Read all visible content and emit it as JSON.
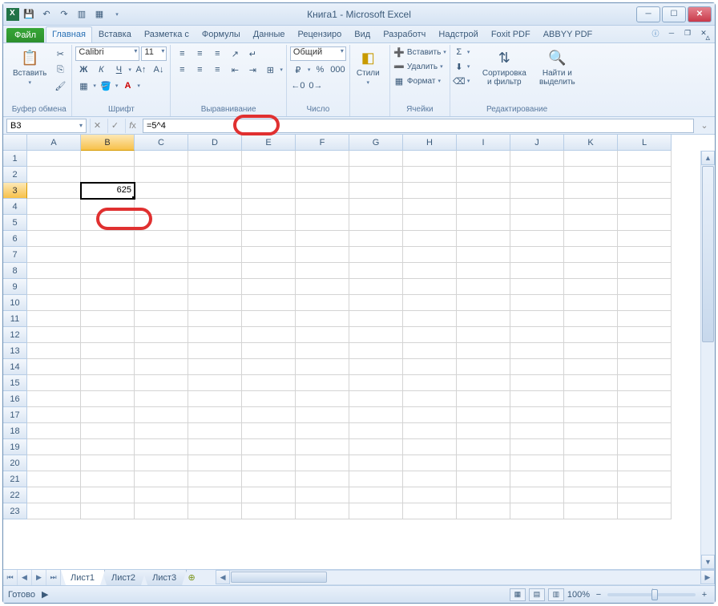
{
  "title": "Книга1 - Microsoft Excel",
  "ribbon": {
    "file": "Файл",
    "tabs": [
      "Главная",
      "Вставка",
      "Разметка с",
      "Формулы",
      "Данные",
      "Рецензиро",
      "Вид",
      "Разработч",
      "Надстрой",
      "Foxit PDF",
      "ABBYY PDF"
    ],
    "active_tab": 0,
    "groups": {
      "clipboard": {
        "label": "Буфер обмена",
        "paste": "Вставить"
      },
      "font": {
        "label": "Шрифт",
        "name": "Calibri",
        "size": "11"
      },
      "align": {
        "label": "Выравнивание"
      },
      "number": {
        "label": "Число",
        "format": "Общий"
      },
      "styles": {
        "label": "",
        "btn": "Стили"
      },
      "cells": {
        "label": "Ячейки",
        "insert": "Вставить",
        "delete": "Удалить",
        "format": "Формат"
      },
      "editing": {
        "label": "Редактирование",
        "sort": "Сортировка и фильтр",
        "find": "Найти и выделить"
      }
    }
  },
  "namebox": "B3",
  "formula": "=5^4",
  "columns": [
    "A",
    "B",
    "C",
    "D",
    "E",
    "F",
    "G",
    "H",
    "I",
    "J",
    "K",
    "L"
  ],
  "active_col": 1,
  "active_row": 2,
  "row_count": 23,
  "cell_value": "625",
  "sheets": [
    "Лист1",
    "Лист2",
    "Лист3"
  ],
  "active_sheet": 0,
  "status": "Готово",
  "zoom": "100%"
}
